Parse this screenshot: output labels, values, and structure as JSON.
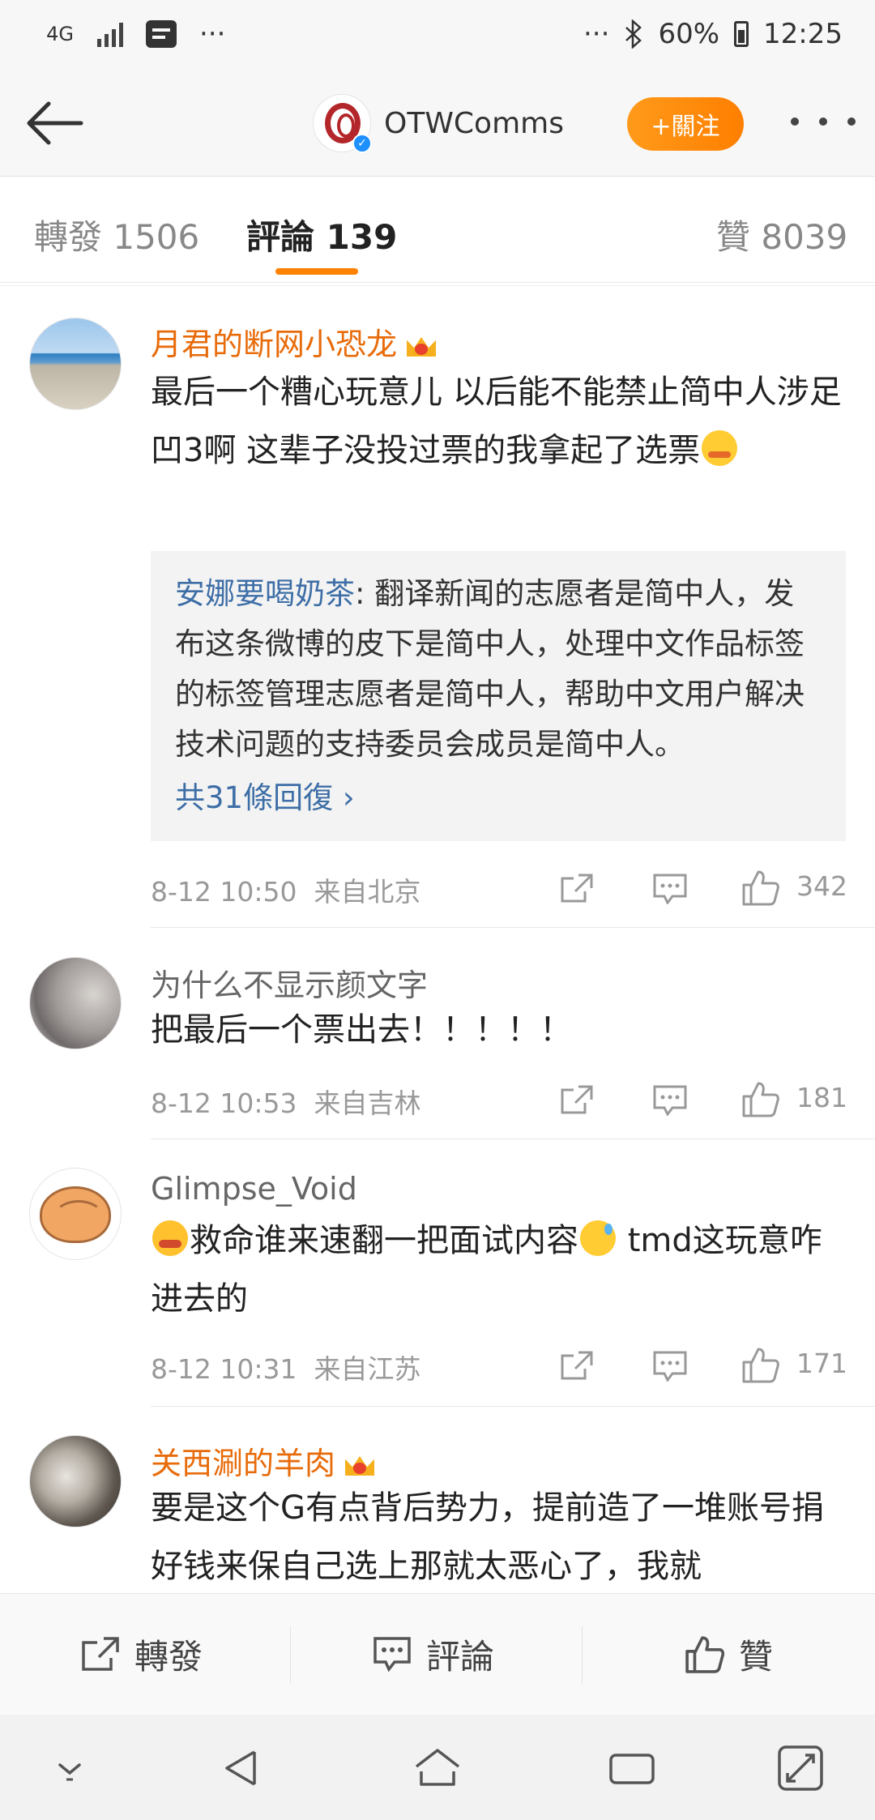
{
  "status_bar": {
    "network": "4G",
    "more": "···",
    "right_more": "···",
    "battery": "60%",
    "time": "12:25"
  },
  "header": {
    "account_name": "OTWComms",
    "follow_label": "+關注"
  },
  "tabs": {
    "repost": "轉發 1506",
    "comments": "評論 139",
    "likes": "贊 8039"
  },
  "comments": [
    {
      "username": "月君的断网小恐龙",
      "vip": true,
      "text": "最后一个糟心玩意儿 以后能不能禁止简中人涉足凹3啊 这辈子没投过票的我拿起了选票",
      "reply": {
        "author": "安娜要喝奶茶",
        "text": ": 翻译新闻的志愿者是简中人，发布这条微博的皮下是简中人，处理中文作品标签的标签管理志愿者是简中人，帮助中文用户解决技术问题的支持委员会成员是简中人。",
        "more": "共31條回復"
      },
      "time": "8-12 10:50",
      "location": "来自北京",
      "likes": "342"
    },
    {
      "username": "为什么不显示颜文字",
      "vip": false,
      "text": "把最后一个票出去！！！！！",
      "time": "8-12 10:53",
      "location": "来自吉林",
      "likes": "181"
    },
    {
      "username": "Glimpse_Void",
      "vip": false,
      "text_a": "救命谁来速翻一把面试内容",
      "text_b": " tmd这玩意咋进去的",
      "time": "8-12 10:31",
      "location": "来自江苏",
      "likes": "171"
    },
    {
      "username": "关西涮的羊肉",
      "vip": true,
      "text": "要是这个G有点背后势力，提前造了一堆账号捐好钱来保自己选上那就太恶心了，我就"
    }
  ],
  "bottom_bar": {
    "repost": "轉發",
    "comment": "評論",
    "like": "贊"
  },
  "colors": {
    "accent": "#ff8200",
    "vip_name": "#e86b0a",
    "link": "#3d6ea6"
  }
}
